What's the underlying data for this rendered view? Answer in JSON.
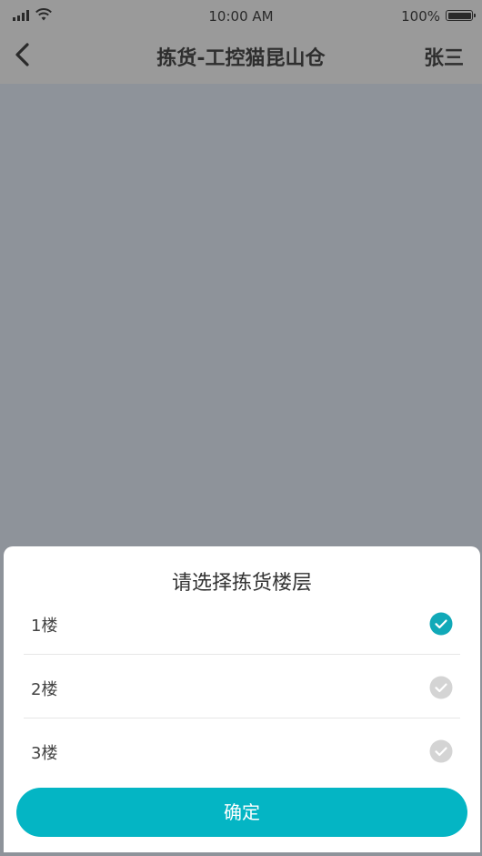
{
  "status_bar": {
    "time": "10:00 AM",
    "battery_percent": "100%",
    "battery_level": 1.0,
    "signal_icon": "cellular-signal-icon",
    "wifi_icon": "wifi-icon",
    "battery_icon": "battery-icon"
  },
  "nav": {
    "back_icon": "chevron-left-icon",
    "title": "拣货-工控猫昆山仓",
    "user": "张三"
  },
  "sheet": {
    "title": "请选择拣货楼层",
    "options": [
      {
        "label": "1楼",
        "selected": true
      },
      {
        "label": "2楼",
        "selected": false
      },
      {
        "label": "3楼",
        "selected": false
      }
    ],
    "confirm_label": "确定"
  },
  "colors": {
    "accent": "#04b5c4",
    "check_selected": "#11a9b8",
    "check_unselected": "#d4d4d4",
    "overlay": "#8e939a",
    "nav_background": "#9a9a9a"
  }
}
